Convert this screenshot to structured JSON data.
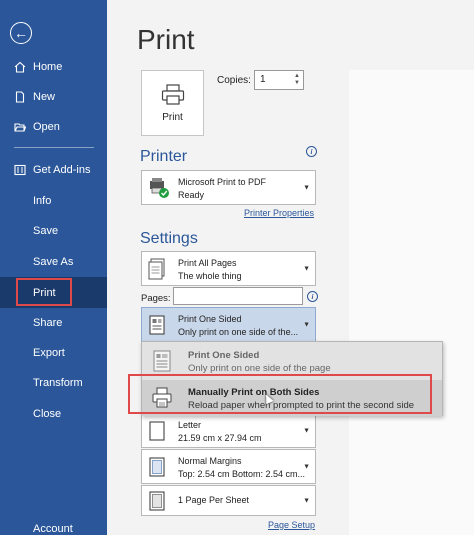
{
  "sidebar": {
    "back_icon": "back-arrow-icon",
    "items": [
      {
        "label": "Home",
        "icon": "home-icon"
      },
      {
        "label": "New",
        "icon": "new-document-icon"
      },
      {
        "label": "Open",
        "icon": "folder-open-icon"
      },
      {
        "label": "Get Add-ins",
        "icon": "store-icon"
      },
      {
        "label": "Info"
      },
      {
        "label": "Save"
      },
      {
        "label": "Save As"
      },
      {
        "label": "Print",
        "active": true
      },
      {
        "label": "Share"
      },
      {
        "label": "Export"
      },
      {
        "label": "Transform"
      },
      {
        "label": "Close"
      },
      {
        "label": "Account"
      }
    ],
    "bg_color": "#2b579a"
  },
  "main": {
    "title": "Print",
    "print_button_label": "Print",
    "copies_label": "Copies:",
    "copies_value": "1",
    "printer": {
      "heading": "Printer",
      "name": "Microsoft Print to PDF",
      "status": "Ready",
      "properties_link": "Printer Properties"
    },
    "settings": {
      "heading": "Settings",
      "pages_range": {
        "line1": "Print All Pages",
        "line2": "The whole thing"
      },
      "pages_label": "Pages:",
      "pages_value": "",
      "sides": {
        "line1": "Print One Sided",
        "line2": "Only print on one side of the..."
      },
      "sides_menu": [
        {
          "title": "Print One Sided",
          "desc": "Only print on one side of the page"
        },
        {
          "title": "Manually Print on Both Sides",
          "desc": "Reload paper when prompted to print the second side",
          "highlighted": true
        }
      ],
      "paper": {
        "line1": "Letter",
        "line2": "21.59 cm x 27.94 cm"
      },
      "margins": {
        "line1": "Normal Margins",
        "line2": "Top: 2.54 cm Bottom: 2.54 cm..."
      },
      "per_sheet": {
        "line1": "1 Page Per Sheet"
      },
      "page_setup_link": "Page Setup"
    }
  },
  "colors": {
    "accent": "#2b579a",
    "highlight_box": "#e0494a"
  }
}
